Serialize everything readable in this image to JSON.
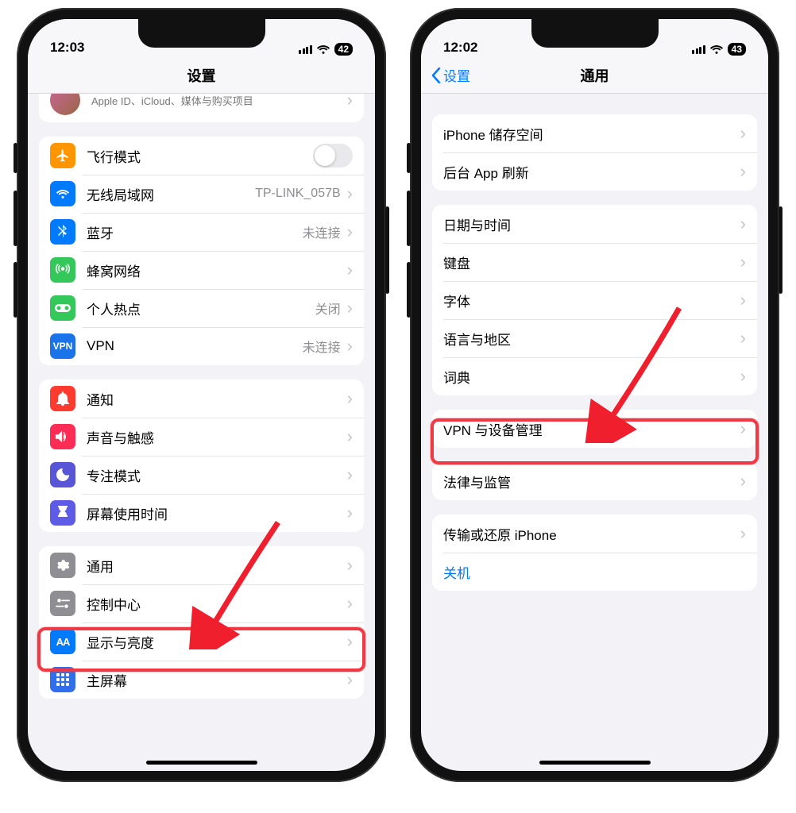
{
  "left": {
    "time": "12:03",
    "battery": "42",
    "title": "设置",
    "appleid_sub": "Apple ID、iCloud、媒体与购买项目",
    "rows": {
      "airplane": "飞行模式",
      "wifi": "无线局域网",
      "wifi_val": "TP-LINK_057B",
      "bt": "蓝牙",
      "bt_val": "未连接",
      "cellular": "蜂窝网络",
      "hotspot": "个人热点",
      "hotspot_val": "关闭",
      "vpn": "VPN",
      "vpn_val": "未连接",
      "notif": "通知",
      "sound": "声音与触感",
      "focus": "专注模式",
      "screentime": "屏幕使用时间",
      "general": "通用",
      "control": "控制中心",
      "display": "显示与亮度",
      "home": "主屏幕"
    }
  },
  "right": {
    "time": "12:02",
    "battery": "43",
    "back": "设置",
    "title": "通用",
    "rows": {
      "storage": "iPhone 储存空间",
      "bgapp": "后台 App 刷新",
      "datetime": "日期与时间",
      "keyboard": "键盘",
      "fonts": "字体",
      "lang": "语言与地区",
      "dict": "词典",
      "vpndm": "VPN 与设备管理",
      "legal": "法律与监管",
      "transfer": "传输或还原 iPhone",
      "shutdown": "关机"
    }
  },
  "colors": {
    "orange": "#ff9500",
    "blue": "#007aff",
    "green": "#34c759",
    "red": "#ff3b30",
    "pink": "#ff2d55",
    "purple": "#5856d6",
    "indigo": "#5e5ce6",
    "gray": "#8e8e93",
    "vpnblue": "#1a73e8",
    "grid": "#2f6fed"
  }
}
